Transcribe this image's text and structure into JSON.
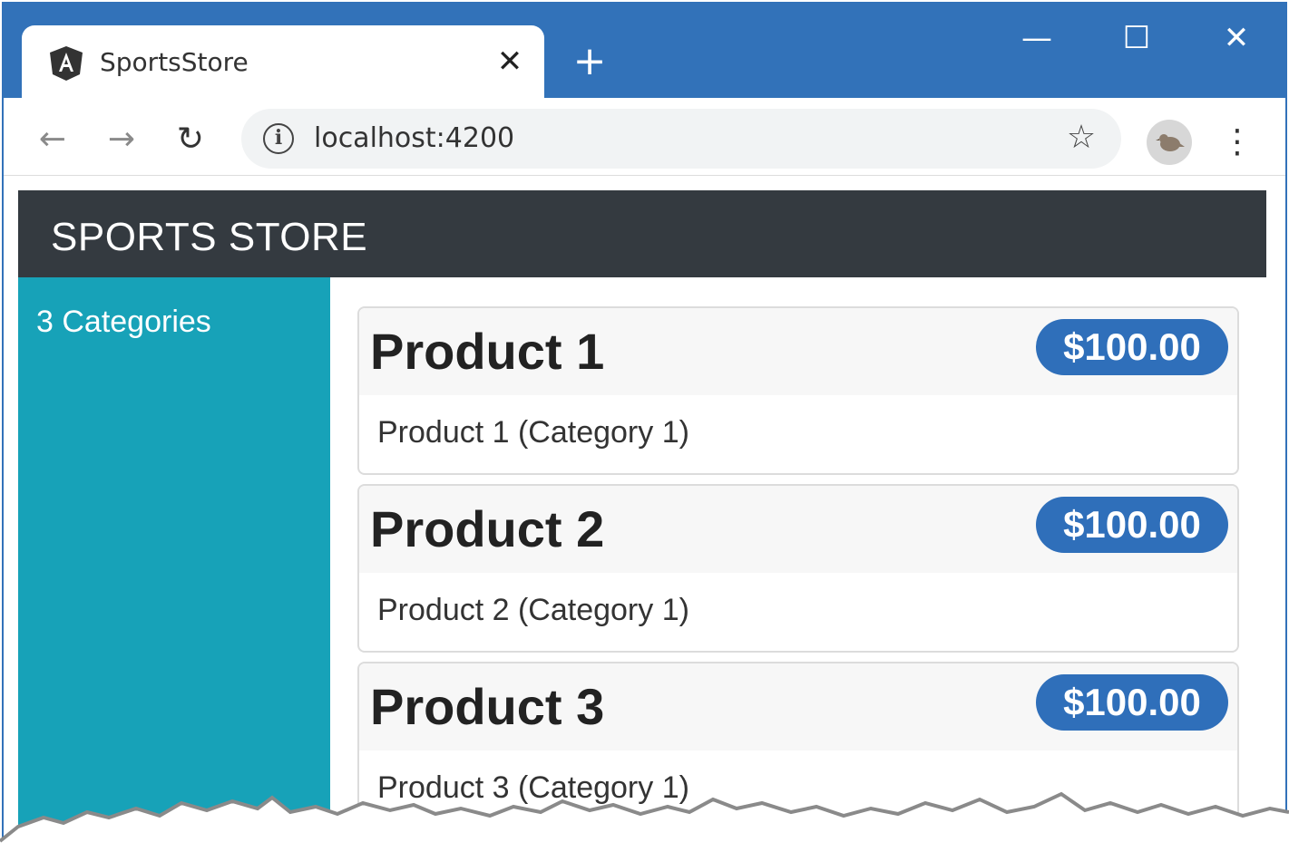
{
  "browser": {
    "tab_title": "SportsStore",
    "tab_close": "✕",
    "new_tab": "+",
    "window_controls": {
      "minimize": "—",
      "maximize": "☐",
      "close": "✕"
    },
    "nav": {
      "back": "←",
      "forward": "→",
      "reload": "↻"
    },
    "url": "localhost:4200",
    "star": "☆",
    "menu": "⋮",
    "icons": {
      "favicon": "angular-logo-icon",
      "site_info": "info-icon",
      "bookmark": "star-icon",
      "profile": "avatar-icon",
      "menu": "kebab-menu-icon"
    }
  },
  "app": {
    "brand": "SPORTS STORE",
    "sidebar": {
      "category_count": "3 Categories"
    },
    "products": [
      {
        "name": "Product 1",
        "price": "$100.00",
        "description": "Product 1 (Category 1)"
      },
      {
        "name": "Product 2",
        "price": "$100.00",
        "description": "Product 2 (Category 1)"
      },
      {
        "name": "Product 3",
        "price": "$100.00",
        "description": "Product 3 (Category 1)"
      }
    ]
  },
  "colors": {
    "titlebar": "#3272b9",
    "navbar": "#343a40",
    "sidebar": "#17a2b8",
    "badge": "#2f6fba"
  }
}
